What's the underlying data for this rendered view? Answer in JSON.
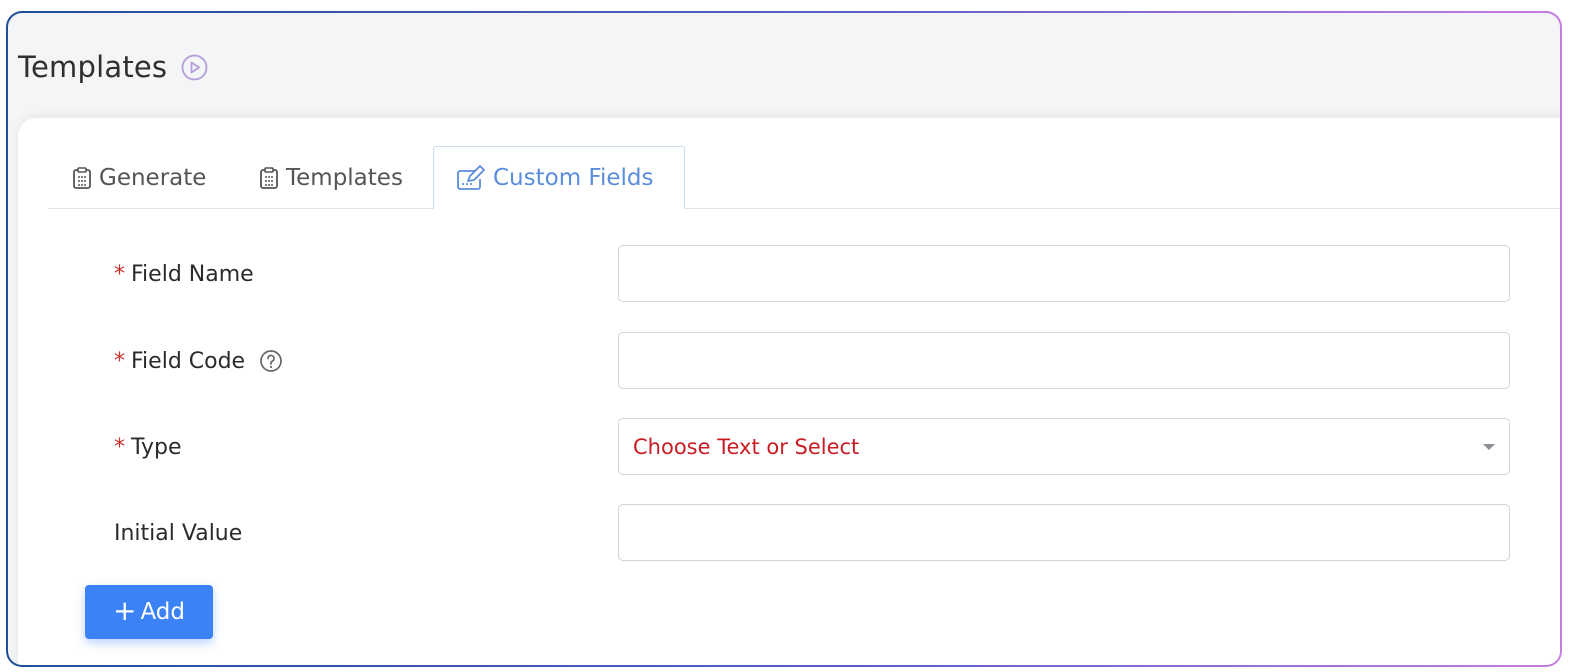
{
  "colors": {
    "accent": "#3b82f6",
    "active_tab": "#5b8ddb",
    "required": "#c9302c",
    "select_placeholder": "#c81d25",
    "play_icon": "#b39ddb"
  },
  "header": {
    "title": "Templates",
    "icon": "play-circle-icon"
  },
  "tabs": [
    {
      "label": "Generate",
      "icon": "clipboard-icon",
      "active": false
    },
    {
      "label": "Templates",
      "icon": "clipboard-icon",
      "active": false
    },
    {
      "label": "Custom Fields",
      "icon": "edit-icon",
      "active": true
    }
  ],
  "form": {
    "field_name": {
      "label": "Field Name",
      "required_mark": "*",
      "value": ""
    },
    "field_code": {
      "label": "Field Code",
      "required_mark": "*",
      "value": "",
      "help_icon": "question-circle-icon"
    },
    "type": {
      "label": "Type",
      "required_mark": "*",
      "selected": "Choose Text or Select"
    },
    "initial_value": {
      "label": "Initial Value",
      "value": ""
    }
  },
  "add_button": {
    "label": "Add",
    "icon": "plus-icon",
    "icon_glyph": "+"
  }
}
